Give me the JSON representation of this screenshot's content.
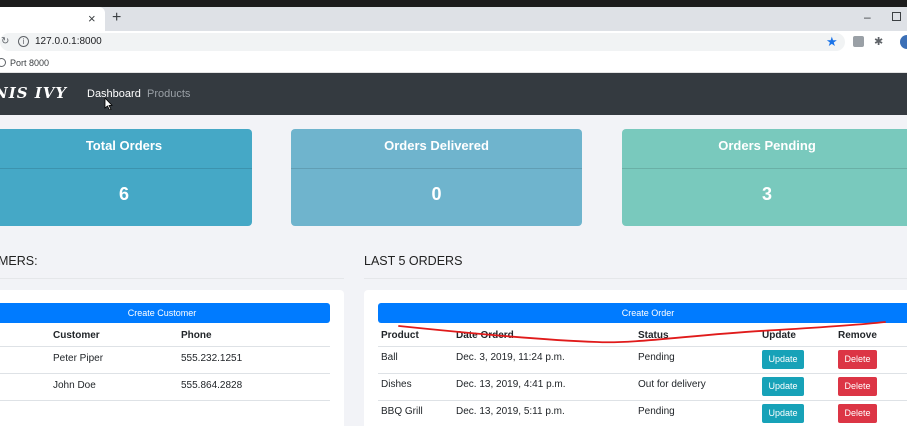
{
  "browser": {
    "tab_close": "×",
    "new_tab": "+",
    "url": "127.0.0.1:8000",
    "bookmark_label": "Port 8000",
    "minimize": "–"
  },
  "nav": {
    "brand": "NIS IVY",
    "links": [
      "Dashboard",
      "Products"
    ]
  },
  "stats": [
    {
      "title": "Total Orders",
      "value": "6",
      "color": "#45a8c6"
    },
    {
      "title": "Orders Delivered",
      "value": "0",
      "color": "#6fb4cd"
    },
    {
      "title": "Orders Pending",
      "value": "3",
      "color": "#79c9bd"
    }
  ],
  "customers": {
    "heading": "MERS:",
    "create_label": "Create Customer",
    "headers": [
      "Customer",
      "Phone"
    ],
    "rows": [
      {
        "name": "Peter Piper",
        "phone": "555.232.1251"
      },
      {
        "name": "John Doe",
        "phone": "555.864.2828"
      }
    ]
  },
  "orders": {
    "heading": "LAST 5 ORDERS",
    "create_label": "Create Order",
    "headers": [
      "Product",
      "Date Orderd",
      "Status",
      "Update",
      "Remove"
    ],
    "update_label": "Update",
    "delete_label": "Delete",
    "rows": [
      {
        "product": "Ball",
        "date": "Dec. 3, 2019, 11:24 p.m.",
        "status": "Pending"
      },
      {
        "product": "Dishes",
        "date": "Dec. 13, 2019, 4:41 p.m.",
        "status": "Out for delivery"
      },
      {
        "product": "BBQ Grill",
        "date": "Dec. 13, 2019, 5:11 p.m.",
        "status": "Pending"
      }
    ]
  },
  "colors": {
    "navbar": "#343a40",
    "primary": "#007bff",
    "info": "#17a2b8",
    "danger": "#dc3545",
    "annotation": "#e01b1b"
  }
}
